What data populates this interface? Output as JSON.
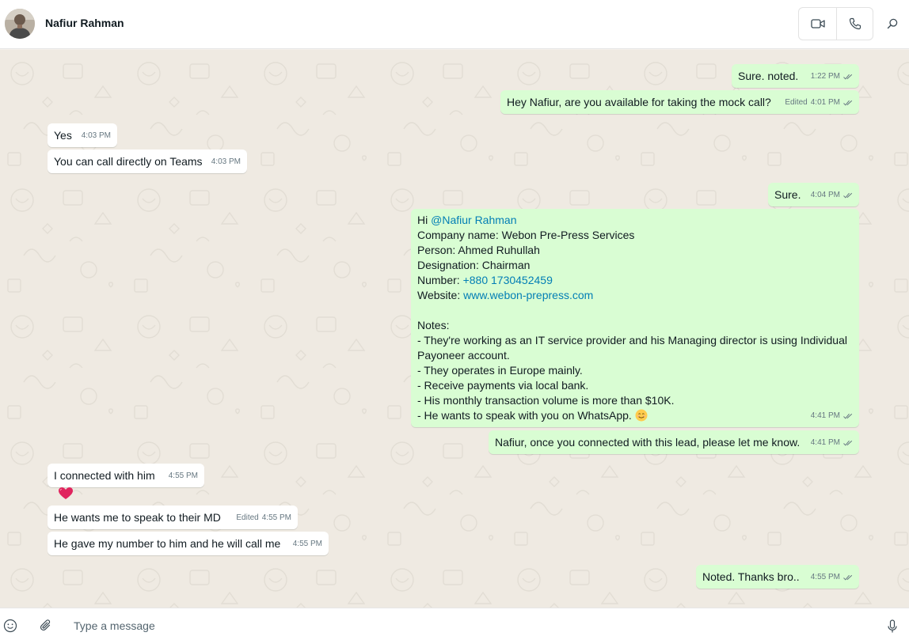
{
  "header": {
    "contact_name": "Nafiur Rahman",
    "video_call_icon": "video-camera-icon",
    "voice_call_icon": "phone-icon",
    "search_icon": "search-icon"
  },
  "messages": [
    {
      "direction": "outgoing",
      "text": "Sure. noted.",
      "time": "1:22 PM",
      "edited": "",
      "status": "read"
    },
    {
      "direction": "outgoing",
      "text": "Hey Nafiur, are you available for taking the mock call?",
      "time": "4:01 PM",
      "edited": "Edited",
      "status": "read"
    },
    {
      "direction": "incoming",
      "text": "Yes",
      "time": "4:03 PM",
      "edited": ""
    },
    {
      "direction": "incoming",
      "text": "You can call directly on Teams",
      "time": "4:03 PM",
      "edited": ""
    },
    {
      "direction": "outgoing",
      "text": "Sure.",
      "time": "4:04 PM",
      "edited": "",
      "status": "read"
    },
    {
      "direction": "outgoing",
      "greeting": "Hi ",
      "mention": "@Nafiur Rahman",
      "company": "Company name: Webon Pre-Press Services",
      "person": "Person: Ahmed Ruhullah",
      "designation": "Designation: Chairman",
      "number_label": "Number: ",
      "number": "+880 1730452459",
      "website_label": "Website: ",
      "website": "www.webon-prepress.com",
      "notes_heading": "Notes:",
      "notes": [
        "- They're working as an IT service provider and his Managing director is using Individual Payoneer account.",
        "- They operates in Europe mainly.",
        "- Receive payments via local bank.",
        "- His monthly transaction volume is more than $10K.",
        "- He wants to speak with you on WhatsApp. "
      ],
      "emoji": "smiling-face-emoji",
      "time": "4:41 PM",
      "status": "read"
    },
    {
      "direction": "outgoing",
      "text": "Nafiur, once you connected with this lead, please let me know.",
      "time": "4:41 PM",
      "edited": "",
      "status": "read"
    },
    {
      "direction": "incoming",
      "text": "I connected with him",
      "time": "4:55 PM",
      "edited": "",
      "reaction": "red-heart-reaction"
    },
    {
      "direction": "incoming",
      "text": "He wants me to speak to their MD",
      "time": "4:55 PM",
      "edited": "Edited"
    },
    {
      "direction": "incoming",
      "text": "He gave my number to him and he will call me",
      "time": "4:55 PM",
      "edited": ""
    },
    {
      "direction": "outgoing",
      "text": "Noted. Thanks bro..",
      "time": "4:55 PM",
      "edited": "",
      "status": "read"
    }
  ],
  "composer": {
    "placeholder": "Type a message",
    "emoji_icon": "emoji-icon",
    "attach_icon": "paperclip-icon",
    "mic_icon": "microphone-icon"
  },
  "colors": {
    "outgoing_bubble": "#d9fdd3",
    "incoming_bubble": "#ffffff",
    "chat_background": "#efeae2",
    "link": "#027eb5",
    "read_tick": "#667781"
  }
}
